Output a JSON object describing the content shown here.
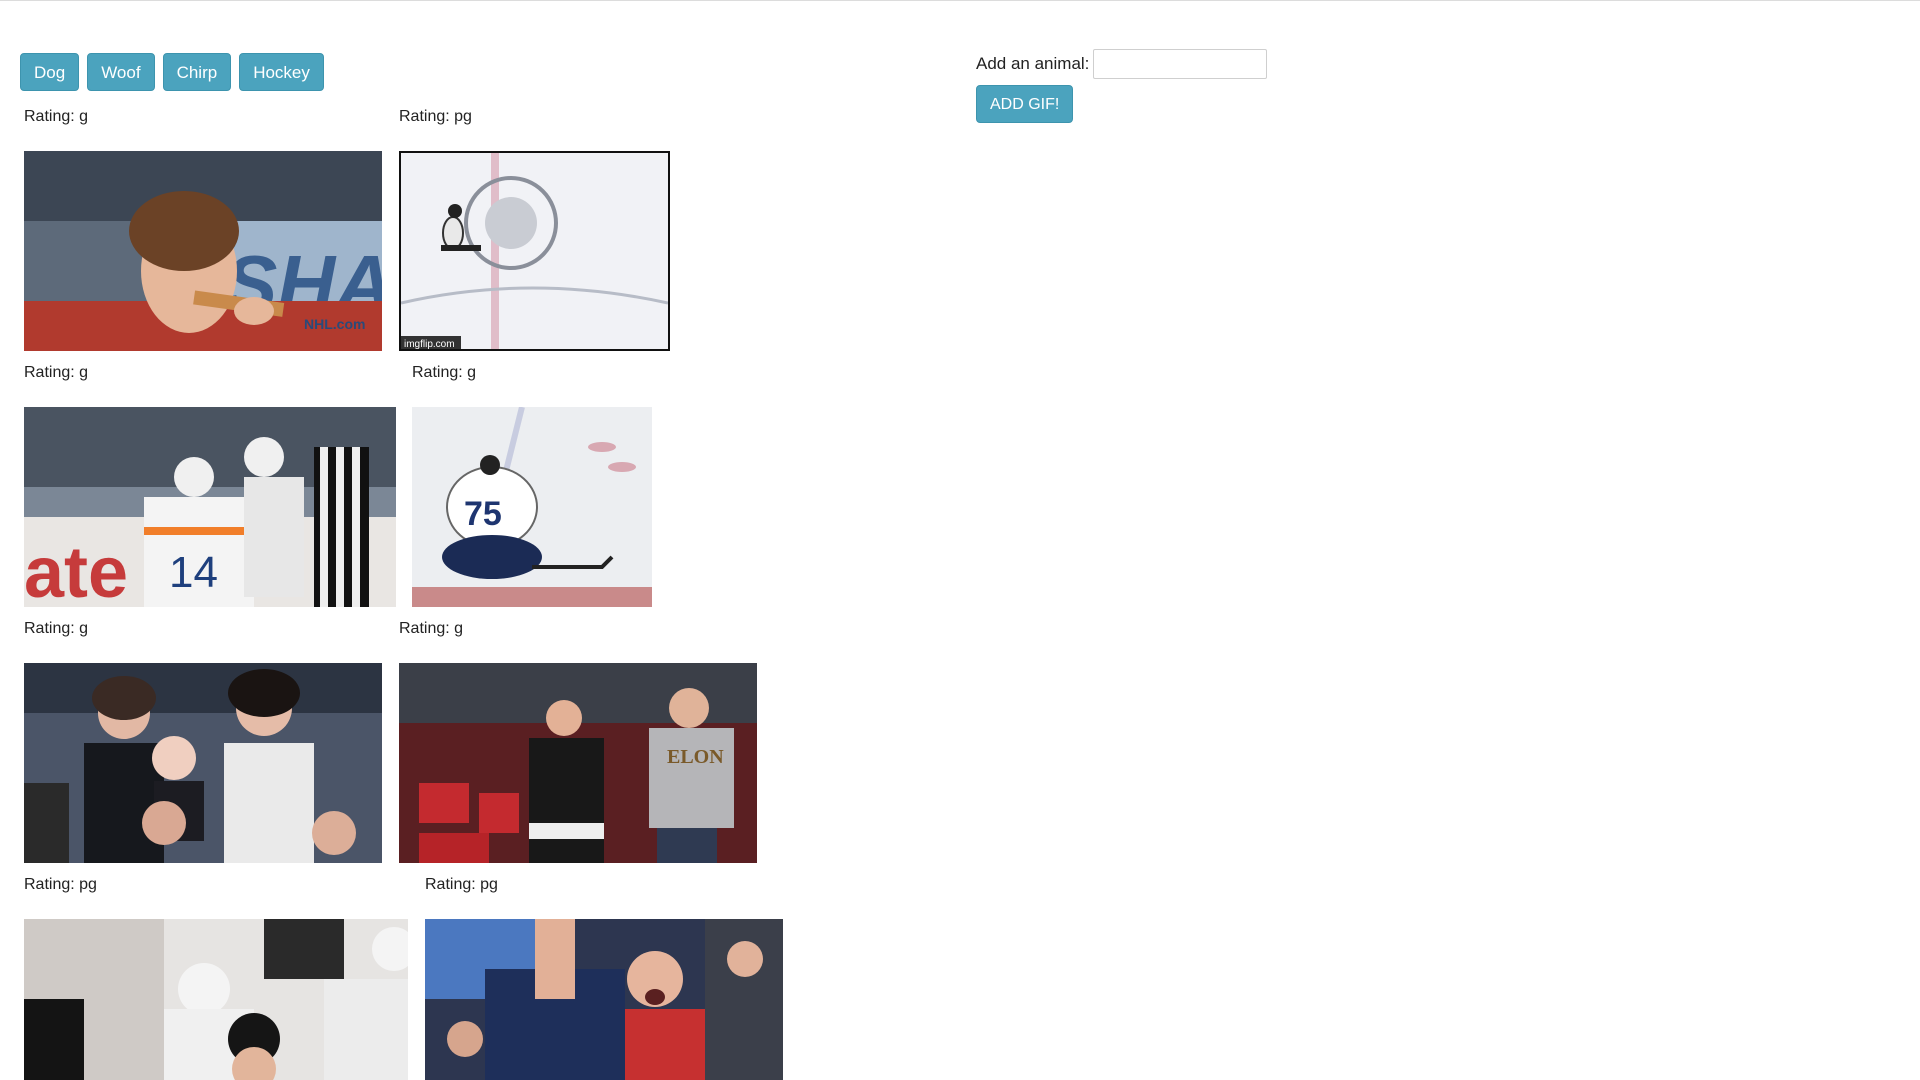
{
  "topics": [
    {
      "label": "Dog"
    },
    {
      "label": "Woof"
    },
    {
      "label": "Chirp"
    },
    {
      "label": "Hockey"
    }
  ],
  "form": {
    "label": "Add an animal:",
    "input_value": "",
    "submit_label": "ADD GIF!"
  },
  "gifs": [
    {
      "rating_label": "Rating: g",
      "desc": "boy-eating-pizza"
    },
    {
      "rating_label": "Rating: pg",
      "desc": "skater-on-rink",
      "watermark": "imgflip.com"
    },
    {
      "rating_label": "Rating: g",
      "desc": "players-bench"
    },
    {
      "rating_label": "Rating: g",
      "desc": "player-kneeling-rink"
    },
    {
      "rating_label": "Rating: g",
      "desc": "fans-with-baby"
    },
    {
      "rating_label": "Rating: g",
      "desc": "fans-cheering"
    },
    {
      "rating_label": "Rating: pg",
      "desc": "players-celebrating"
    },
    {
      "rating_label": "Rating: pg",
      "desc": "fans-shouting"
    }
  ]
}
